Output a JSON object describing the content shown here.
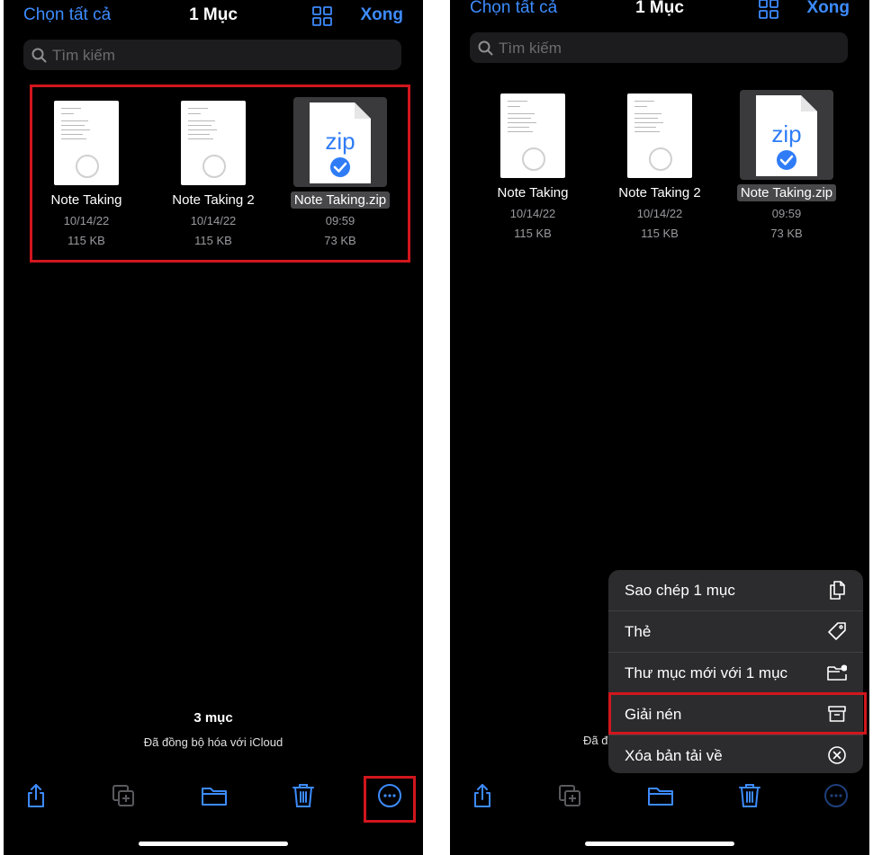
{
  "nav": {
    "select_all": "Chọn tất cả",
    "title": "1 Mục",
    "done": "Xong"
  },
  "search": {
    "placeholder": "Tìm kiếm"
  },
  "files": [
    {
      "name": "Note Taking",
      "date": "10/14/22",
      "size": "115 KB"
    },
    {
      "name": "Note Taking 2",
      "date": "10/14/22",
      "size": "115 KB"
    },
    {
      "name": "Note Taking.zip",
      "date": "09:59",
      "size": "73 KB",
      "badge": "zip"
    }
  ],
  "footer": {
    "count": "3 mục",
    "sync": "Đã đồng bộ hóa với iCloud",
    "sync_partial": "Đã đ"
  },
  "menu": [
    {
      "label": "Sao chép 1 mục",
      "icon": "copy-icon"
    },
    {
      "label": "Thẻ",
      "icon": "tag-icon"
    },
    {
      "label": "Thư mục mới với 1 mục",
      "icon": "new-folder-icon"
    },
    {
      "label": "Giải nén",
      "icon": "archive-icon"
    },
    {
      "label": "Xóa bản tải về",
      "icon": "remove-download-icon"
    }
  ],
  "colors": {
    "accent": "#3d8bfd",
    "highlight": "#d1161d",
    "background": "#000000"
  }
}
